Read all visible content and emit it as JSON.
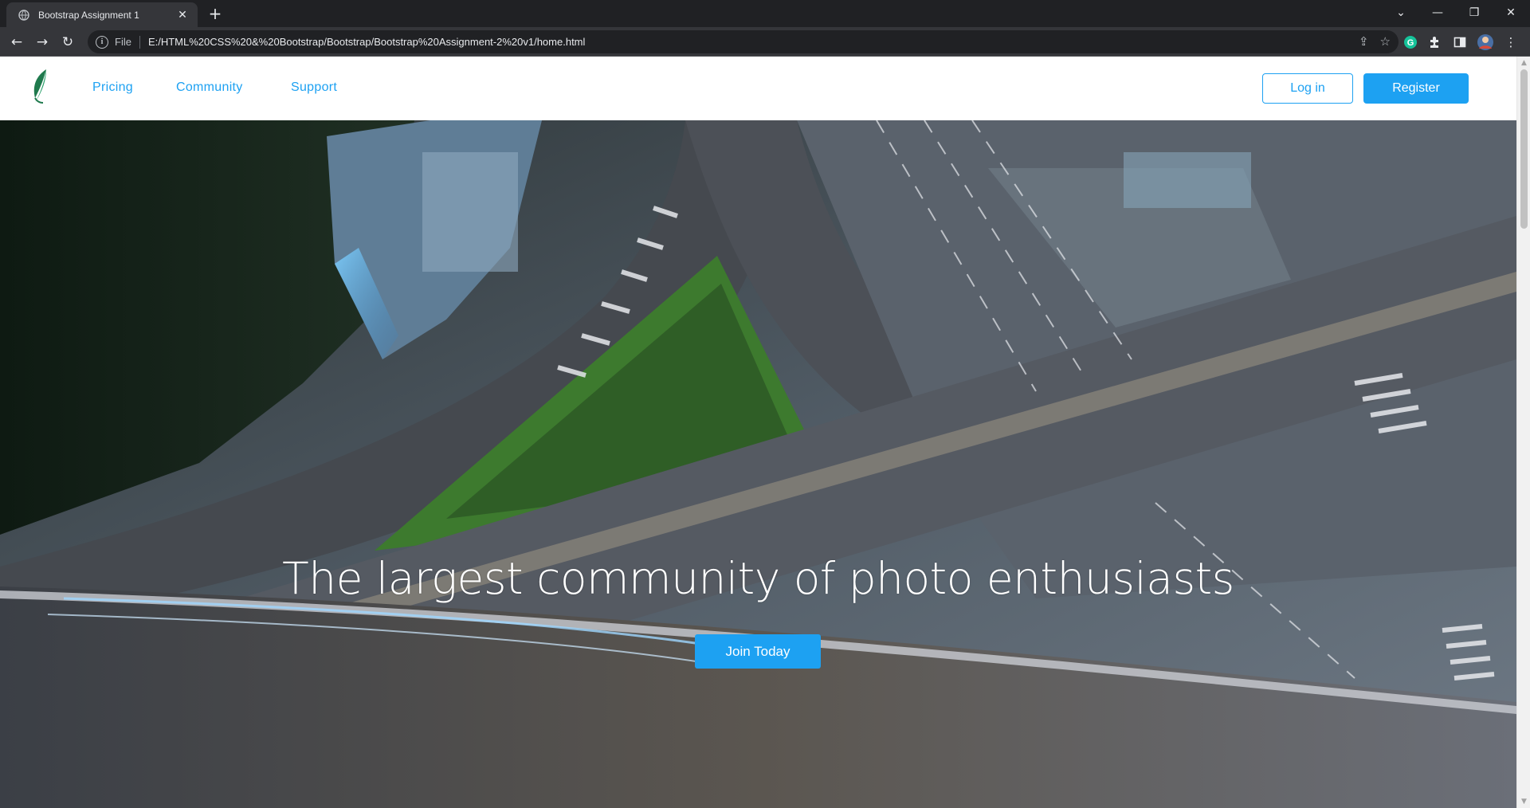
{
  "browser": {
    "tab_title": "Bootstrap Assignment 1",
    "tab_close": "✕",
    "new_tab": "+",
    "url_scheme": "File",
    "url": "E:/HTML%20CSS%20&%20Bootstrap/Bootstrap/Bootstrap%20Assignment-2%20v1/home.html"
  },
  "navbar": {
    "links": [
      "Pricing",
      "Community",
      "Support"
    ],
    "login_label": "Log in",
    "register_label": "Register"
  },
  "hero": {
    "title": "The largest community of photo enthusiasts",
    "cta_label": "Join Today"
  },
  "colors": {
    "accent": "#1da1f2",
    "chrome_dark": "#202124",
    "chrome_toolbar": "#35363a"
  }
}
